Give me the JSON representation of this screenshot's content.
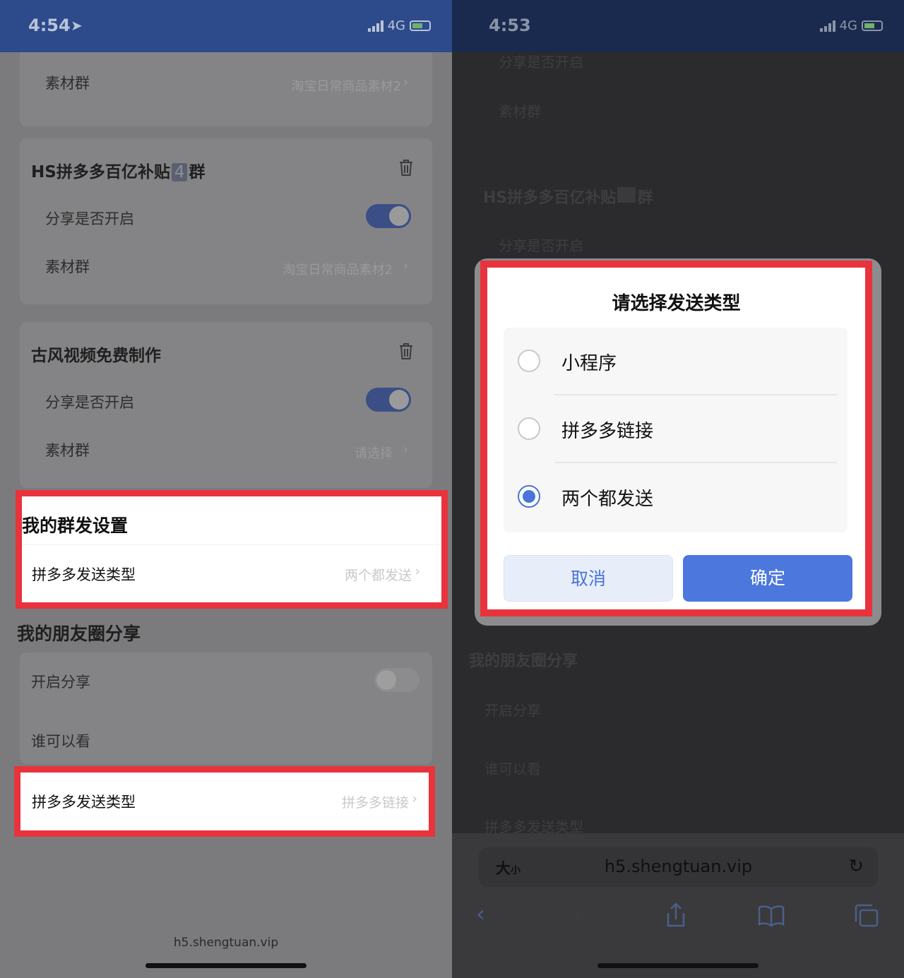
{
  "left": {
    "status": {
      "time": "4:54",
      "network": "4G"
    },
    "card1": {
      "label": "素材群",
      "value": "淘宝日常商品素材2"
    },
    "group2": {
      "title": "HS拼多多百亿补贴",
      "badge": "4",
      "title_suffix": "群",
      "share_label": "分享是否开启",
      "material_label": "素材群",
      "material_value": "淘宝日常商品素材2"
    },
    "group3": {
      "title": "古风视频免费制作",
      "share_label": "分享是否开启",
      "material_label": "素材群",
      "material_value": "请选择"
    },
    "group_send": {
      "title": "我的群发设置",
      "type_label": "拼多多发送类型",
      "type_value": "两个都发送"
    },
    "moments": {
      "title": "我的朋友圈分享",
      "open_label": "开启分享",
      "who_label": "谁可以看",
      "type_label": "拼多多发送类型",
      "type_value": "拼多多链接"
    },
    "url": "h5.shengtuan.vip"
  },
  "right": {
    "status": {
      "time": "4:53",
      "network": "4G"
    },
    "bg": {
      "share_label": "分享是否开启",
      "material_label": "素材群",
      "group_title": "HS拼多多百亿补贴",
      "group_suffix": "群",
      "share_label2": "分享是否开启",
      "moments_title": "我的朋友圈分享",
      "open_label": "开启分享",
      "who_label": "谁可以看",
      "type_label": "拼多多发送类型"
    },
    "dialog": {
      "title": "请选择发送类型",
      "options": [
        {
          "label": "小程序",
          "checked": false
        },
        {
          "label": "拼多多链接",
          "checked": false
        },
        {
          "label": "两个都发送",
          "checked": true
        }
      ],
      "cancel": "取消",
      "confirm": "确定"
    },
    "safari": {
      "size_label": "大",
      "size_small": "小",
      "url": "h5.shengtuan.vip"
    }
  },
  "colors": {
    "highlight": "#e8333d",
    "accent": "#4c77dc",
    "status_bar": "#2d4a8a"
  }
}
